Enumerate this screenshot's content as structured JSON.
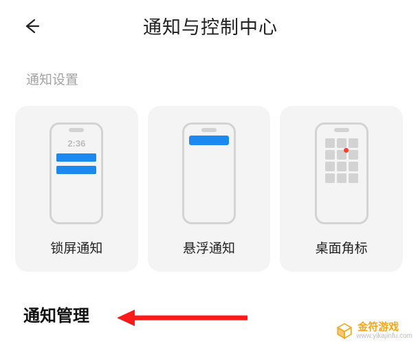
{
  "header": {
    "title": "通知与控制中心"
  },
  "section_label": "通知设置",
  "cards": [
    {
      "label": "锁屏通知",
      "lock_time": "2:36"
    },
    {
      "label": "悬浮通知"
    },
    {
      "label": "桌面角标"
    }
  ],
  "management_label": "通知管理",
  "watermark": {
    "brand_cn": "金符游戏",
    "brand_url": "www.yikajinfu.com"
  },
  "colors": {
    "accent_blue": "#1c89f1",
    "badge_red": "#ff3a2f",
    "arrow_red": "#ff1a1a",
    "wm_gold": "#f7a61b",
    "card_bg": "#f4f4f4"
  }
}
